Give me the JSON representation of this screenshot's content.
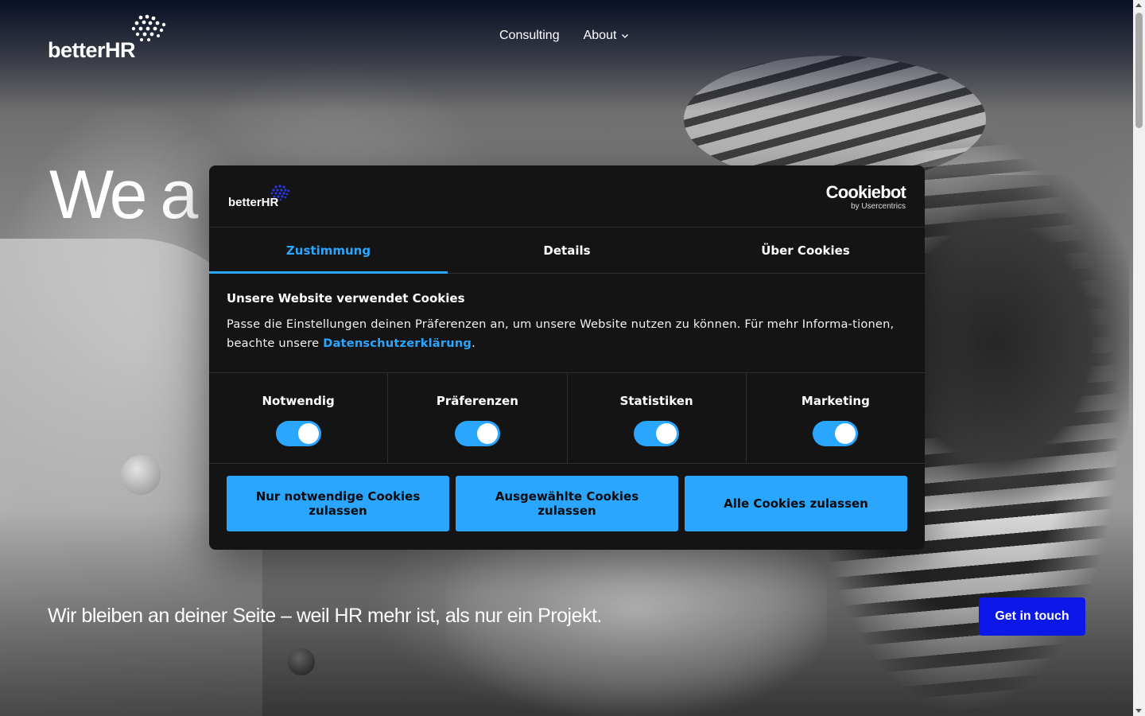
{
  "site": {
    "logo_text": "betterHR",
    "nav": [
      {
        "label": "Consulting"
      },
      {
        "label": "About"
      }
    ],
    "hero_title": "We a",
    "hero_subtitle": "Wir bleiben an deiner Seite – weil HR mehr ist, als nur ein Projekt.",
    "cta_label": "Get in touch"
  },
  "dialog": {
    "logo_text": "betterHR",
    "provider_name": "Cookiebot",
    "provider_by": "by Usercentrics",
    "tabs": [
      {
        "label": "Zustimmung",
        "active": true
      },
      {
        "label": "Details",
        "active": false
      },
      {
        "label": "Über Cookies",
        "active": false
      }
    ],
    "heading": "Unsere Website verwendet Cookies",
    "text_before": "Passe die Einstellungen deinen Präferenzen an, um unsere Website nutzen zu können. Für mehr Informa-tionen, beachte unsere ",
    "link_text": "Datenschutzerklärung",
    "text_after": ".",
    "categories": [
      {
        "label": "Notwendig",
        "enabled": true
      },
      {
        "label": "Präferenzen",
        "enabled": true
      },
      {
        "label": "Statistiken",
        "enabled": true
      },
      {
        "label": "Marketing",
        "enabled": true
      }
    ],
    "buttons": {
      "necessary": "Nur notwendige Cookies zulassen",
      "selected": "Ausgewählte Cookies zulassen",
      "all": "Alle Cookies zulassen"
    }
  },
  "colors": {
    "accent": "#2aa6ff",
    "cta": "#0b18e8",
    "dialog_bg": "#141414"
  },
  "icons": {
    "logo_mark": "dot-cluster-icon",
    "nav_dropdown": "chevron-down-icon"
  }
}
